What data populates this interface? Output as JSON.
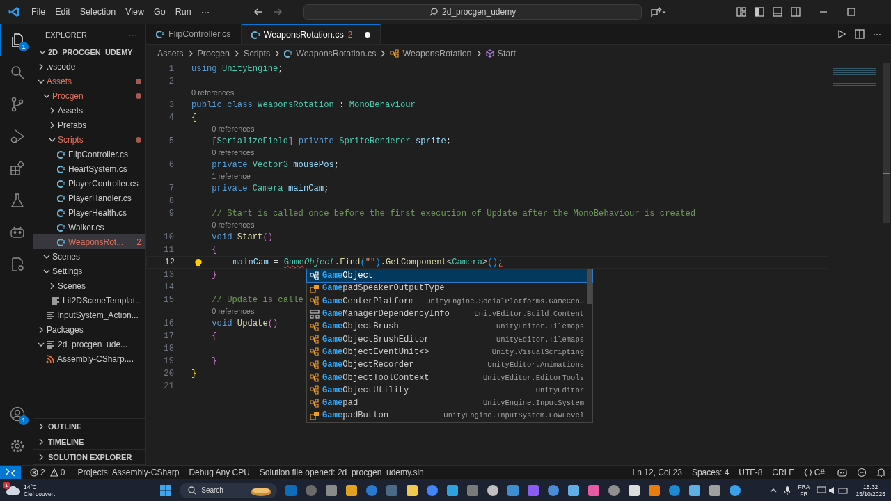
{
  "title_bar": {
    "menu": [
      "File",
      "Edit",
      "Selection",
      "View",
      "Go",
      "Run",
      "···"
    ],
    "search": "2d_procgen_udemy"
  },
  "activity_bar": {
    "explorer_badge": "1",
    "accounts_badge": "1"
  },
  "explorer": {
    "title": "EXPLORER",
    "more": "···",
    "root": "2D_PROCGEN_UDEMY",
    "tree": [
      {
        "label": ".vscode",
        "kind": "folder",
        "expanded": false,
        "modified": false,
        "selected": false
      },
      {
        "label": "Assets",
        "kind": "folder",
        "expanded": true,
        "modified": true,
        "selected": false,
        "children": [
          {
            "label": "Procgen",
            "kind": "folder",
            "expanded": true,
            "modified": true,
            "selected": false,
            "children": [
              {
                "label": "Assets",
                "kind": "folder",
                "expanded": false,
                "modified": false,
                "selected": false
              },
              {
                "label": "Prefabs",
                "kind": "folder",
                "expanded": false,
                "modified": false,
                "selected": false
              },
              {
                "label": "Scripts",
                "kind": "folder",
                "expanded": true,
                "modified": true,
                "selected": false,
                "children": [
                  {
                    "label": "FlipController.cs",
                    "kind": "cs",
                    "modified": false,
                    "selected": false
                  },
                  {
                    "label": "HeartSystem.cs",
                    "kind": "cs",
                    "modified": false,
                    "selected": false
                  },
                  {
                    "label": "PlayerController.cs",
                    "kind": "cs",
                    "modified": false,
                    "selected": false
                  },
                  {
                    "label": "PlayerHandler.cs",
                    "kind": "cs",
                    "modified": false,
                    "selected": false
                  },
                  {
                    "label": "PlayerHealth.cs",
                    "kind": "cs",
                    "modified": false,
                    "selected": false
                  },
                  {
                    "label": "Walker.cs",
                    "kind": "cs",
                    "modified": false,
                    "selected": false
                  },
                  {
                    "label": "WeaponsRot...",
                    "kind": "cs",
                    "modified": true,
                    "selected": true,
                    "badge": "2"
                  }
                ]
              }
            ]
          },
          {
            "label": "Scenes",
            "kind": "folder",
            "expanded": true,
            "modified": false,
            "selected": false
          },
          {
            "label": "Settings",
            "kind": "folder",
            "expanded": true,
            "modified": false,
            "selected": false,
            "children": [
              {
                "label": "Scenes",
                "kind": "folder",
                "expanded": false,
                "modified": false,
                "selected": false
              },
              {
                "label": "Lit2DSceneTemplat...",
                "kind": "file",
                "modified": false,
                "selected": false
              }
            ]
          },
          {
            "label": "InputSystem_Action...",
            "kind": "file",
            "modified": false,
            "selected": false
          }
        ]
      },
      {
        "label": "Packages",
        "kind": "folder",
        "expanded": false,
        "modified": false,
        "selected": false
      },
      {
        "label": "2d_procgen_ude...",
        "kind": "file",
        "expanded": true,
        "modified": false,
        "selected": false,
        "children": [
          {
            "label": "Assembly-CSharp....",
            "kind": "rss",
            "modified": false,
            "selected": false
          }
        ]
      }
    ],
    "sections": [
      "OUTLINE",
      "TIMELINE",
      "SOLUTION EXPLORER"
    ]
  },
  "tabs": [
    {
      "label": "FlipController.cs",
      "selected": false,
      "modified": false
    },
    {
      "label": "WeaponsRotation.cs",
      "selected": true,
      "modified": true,
      "badge": "2",
      "dirty": true
    }
  ],
  "breadcrumbs": [
    {
      "label": "Assets",
      "kind": "text"
    },
    {
      "label": "Procgen",
      "kind": "text"
    },
    {
      "label": "Scripts",
      "kind": "text"
    },
    {
      "label": "WeaponsRotation.cs",
      "kind": "cs"
    },
    {
      "label": "WeaponsRotation",
      "kind": "class"
    },
    {
      "label": "Start",
      "kind": "method"
    }
  ],
  "code": [
    {
      "kind": "line",
      "number": "1",
      "tokens": [
        {
          "kind": "keyword",
          "text": "using "
        },
        {
          "kind": "type",
          "text": "UnityEngine"
        },
        {
          "kind": "plain",
          "text": ";"
        }
      ]
    },
    {
      "kind": "line",
      "number": "2"
    },
    {
      "kind": "lens",
      "text": "0 references"
    },
    {
      "kind": "line",
      "number": "3",
      "tokens": [
        {
          "kind": "keyword",
          "text": "public class "
        },
        {
          "kind": "type",
          "text": "WeaponsRotation"
        },
        {
          "kind": "plain",
          "text": " : "
        },
        {
          "kind": "type",
          "text": "MonoBehaviour"
        }
      ]
    },
    {
      "kind": "line",
      "number": "4",
      "tokens": [
        {
          "kind": "bracket1",
          "text": "{"
        }
      ]
    },
    {
      "kind": "lens",
      "text": "    0 references"
    },
    {
      "kind": "line",
      "number": "5",
      "tokens": [
        {
          "kind": "bracket2",
          "text": "    ["
        },
        {
          "kind": "type",
          "text": "SerializeField"
        },
        {
          "kind": "bracket2",
          "text": "]"
        },
        {
          "kind": "keyword",
          "text": " private "
        },
        {
          "kind": "type",
          "text": "SpriteRenderer"
        },
        {
          "kind": "variable",
          "text": " sprite"
        },
        {
          "kind": "plain",
          "text": ";"
        }
      ]
    },
    {
      "kind": "lens",
      "text": "    0 references"
    },
    {
      "kind": "line",
      "number": "6",
      "tokens": [
        {
          "kind": "keyword",
          "text": "    private "
        },
        {
          "kind": "type",
          "text": "Vector3"
        },
        {
          "kind": "variable",
          "text": " mousePos"
        },
        {
          "kind": "plain",
          "text": ";"
        }
      ]
    },
    {
      "kind": "lens",
      "text": "    1 reference"
    },
    {
      "kind": "line",
      "number": "7",
      "tokens": [
        {
          "kind": "keyword",
          "text": "    private "
        },
        {
          "kind": "type",
          "text": "Camera"
        },
        {
          "kind": "variable",
          "text": " mainCam"
        },
        {
          "kind": "plain",
          "text": ";"
        }
      ]
    },
    {
      "kind": "line",
      "number": "8"
    },
    {
      "kind": "line",
      "number": "9",
      "tokens": [
        {
          "kind": "comment",
          "text": "    // Start is called once before the first execution of Update after the MonoBehaviour is created"
        }
      ]
    },
    {
      "kind": "lens",
      "text": "    0 references"
    },
    {
      "kind": "line",
      "number": "10",
      "tokens": [
        {
          "kind": "keyword",
          "text": "    void "
        },
        {
          "kind": "function",
          "text": "Start"
        },
        {
          "kind": "bracket2",
          "text": "()"
        }
      ]
    },
    {
      "kind": "line",
      "number": "11",
      "tokens": [
        {
          "kind": "bracket2",
          "text": "    {"
        }
      ]
    },
    {
      "kind": "line",
      "number": "12",
      "current": true,
      "lightbulb": true,
      "tokens": [
        {
          "kind": "variable",
          "text": "        mainCam"
        },
        {
          "kind": "plain",
          "text": " = "
        },
        {
          "kind": "type",
          "text": "Game",
          "error": true
        },
        {
          "kind": "type",
          "text": "Object",
          "italic": true
        },
        {
          "kind": "plain",
          "text": "."
        },
        {
          "kind": "function",
          "text": "Find"
        },
        {
          "kind": "bracket3",
          "text": "("
        },
        {
          "kind": "string",
          "text": "\"\""
        },
        {
          "kind": "bracket3",
          "text": ")"
        },
        {
          "kind": "plain",
          "text": "."
        },
        {
          "kind": "function",
          "text": "GetComponent"
        },
        {
          "kind": "plain",
          "text": "<"
        },
        {
          "kind": "type",
          "text": "Camera"
        },
        {
          "kind": "plain",
          "text": ">"
        },
        {
          "kind": "bracket3",
          "text": "()"
        },
        {
          "kind": "plain",
          "text": ";",
          "error": true
        }
      ]
    },
    {
      "kind": "line",
      "number": "13",
      "tokens": [
        {
          "kind": "bracket2",
          "text": "    }"
        }
      ]
    },
    {
      "kind": "line",
      "number": "14"
    },
    {
      "kind": "line",
      "number": "15",
      "tokens": [
        {
          "kind": "comment",
          "text": "    // Update is calle"
        }
      ]
    },
    {
      "kind": "lens",
      "text": "    0 references"
    },
    {
      "kind": "line",
      "number": "16",
      "tokens": [
        {
          "kind": "keyword",
          "text": "    void "
        },
        {
          "kind": "function",
          "text": "Update"
        },
        {
          "kind": "bracket2",
          "text": "()"
        }
      ]
    },
    {
      "kind": "line",
      "number": "17",
      "tokens": [
        {
          "kind": "bracket2",
          "text": "    {"
        }
      ]
    },
    {
      "kind": "line",
      "number": "18"
    },
    {
      "kind": "line",
      "number": "19",
      "tokens": [
        {
          "kind": "bracket2",
          "text": "    }"
        }
      ]
    },
    {
      "kind": "line",
      "number": "20",
      "tokens": [
        {
          "kind": "bracket1",
          "text": "}"
        }
      ]
    },
    {
      "kind": "line",
      "number": "21"
    }
  ],
  "suggest": [
    {
      "match": "Game",
      "rest": "Object",
      "kind": "class",
      "selected": true
    },
    {
      "match": "Game",
      "rest": "padSpeakerOutputType",
      "kind": "enum",
      "selected": false
    },
    {
      "match": "Game",
      "rest": "CenterPlatform",
      "detail": "UnityEngine.SocialPlatforms.GameCen…",
      "kind": "class",
      "selected": false
    },
    {
      "match": "Game",
      "rest": "ManagerDependencyInfo",
      "detail": "UnityEditor.Build.Content",
      "kind": "struct",
      "selected": false
    },
    {
      "match": "Game",
      "rest": "ObjectBrush",
      "detail": "UnityEditor.Tilemaps",
      "kind": "class",
      "selected": false
    },
    {
      "match": "Game",
      "rest": "ObjectBrushEditor",
      "detail": "UnityEditor.Tilemaps",
      "kind": "class",
      "selected": false
    },
    {
      "match": "Game",
      "rest": "ObjectEventUnit<>",
      "detail": "Unity.VisualScripting",
      "kind": "class",
      "selected": false
    },
    {
      "match": "Game",
      "rest": "ObjectRecorder",
      "detail": "UnityEditor.Animations",
      "kind": "class",
      "selected": false
    },
    {
      "match": "Game",
      "rest": "ObjectToolContext",
      "detail": "UnityEditor.EditorTools",
      "kind": "class",
      "selected": false
    },
    {
      "match": "Game",
      "rest": "ObjectUtility",
      "detail": "UnityEditor",
      "kind": "class",
      "selected": false
    },
    {
      "match": "Game",
      "rest": "pad",
      "detail": "UnityEngine.InputSystem",
      "kind": "class",
      "selected": false
    },
    {
      "match": "Game",
      "rest": "padButton",
      "detail": "UnityEngine.InputSystem.LowLevel",
      "kind": "enum",
      "selected": false
    }
  ],
  "status_bar": {
    "errors": "2",
    "warnings": "0",
    "left": [
      "Projects: Assembly-CSharp",
      "Debug Any CPU",
      "Solution file opened: 2d_procgen_udemy.sln"
    ],
    "right": [
      "Ln 12, Col 23",
      "Spaces: 4",
      "UTF-8",
      "CRLF"
    ],
    "language": "C#"
  },
  "taskbar": {
    "weather_badge": "1",
    "temperature": "14°C",
    "weather": "Ciel couvert",
    "search": "Search",
    "lang": "FRA",
    "region": "FR",
    "time": "15:32",
    "date": "15/10/2025"
  }
}
